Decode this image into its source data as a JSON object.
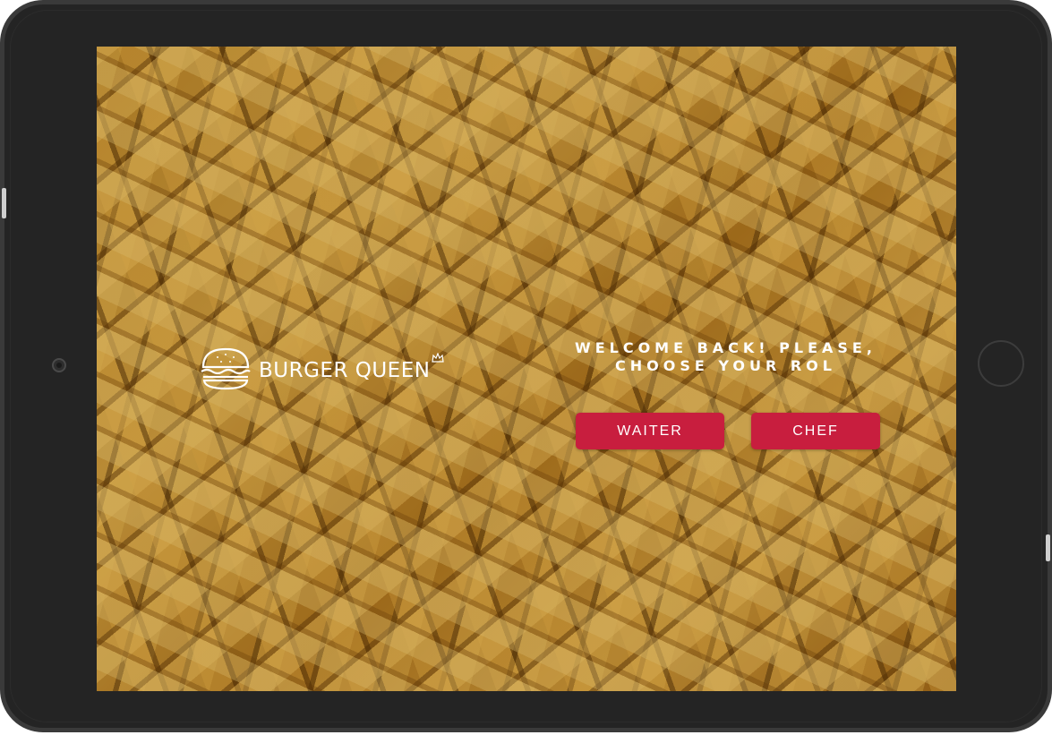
{
  "app": {
    "brand_name": "BURGER QUEEN",
    "logo_icon": "burger-icon",
    "crown_icon": "crown-icon"
  },
  "welcome": {
    "message": "WELCOME BACK! PLEASE, CHOOSE YOUR ROL"
  },
  "roles": {
    "waiter_label": "WAITER",
    "chef_label": "CHEF"
  },
  "colors": {
    "button": "#c81e3e",
    "text": "#ffffff",
    "device_frame": "#242424"
  }
}
